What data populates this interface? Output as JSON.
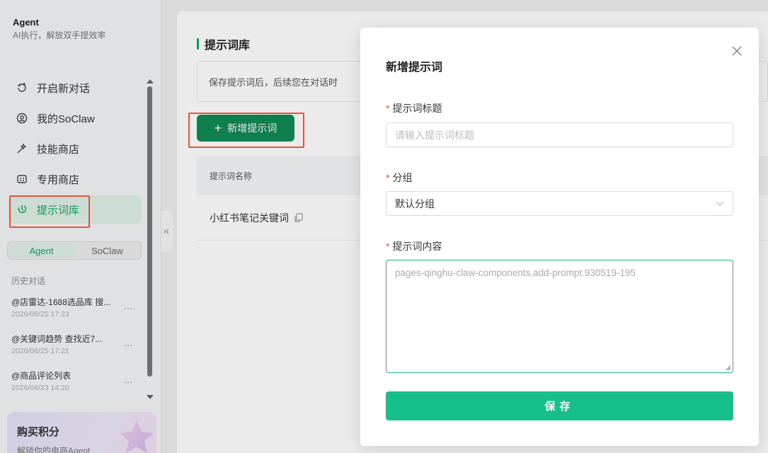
{
  "brand": {
    "title": "Agent",
    "subtitle": "AI执行，解放双手提效率"
  },
  "nav": [
    {
      "label": "开启新对话",
      "icon": "new-chat-icon"
    },
    {
      "label": "我的SoClaw",
      "icon": "user-icon"
    },
    {
      "label": "技能商店",
      "icon": "skill-icon"
    },
    {
      "label": "专用商店",
      "icon": "store-icon"
    },
    {
      "label": "提示词库",
      "icon": "prompt-icon",
      "active": true
    }
  ],
  "segment": {
    "left": "Agent",
    "right": "SoClaw",
    "selected": "Agent"
  },
  "history": {
    "label": "历史对话",
    "items": [
      {
        "title": "@店雷达-1688选品库 搜...",
        "time": "2026/06/25 17:23"
      },
      {
        "title": "@关键词趋势 查找近7...",
        "time": "2026/06/25 17:21"
      },
      {
        "title": "@商品评论列表",
        "time": "2026/06/23 14:20"
      }
    ],
    "more": "..."
  },
  "promo": {
    "title": "购买积分",
    "subtitle": "解锁你的电商Agent"
  },
  "main": {
    "title": "提示词库",
    "info": "保存提示词后，后续您在对话时",
    "add_button": "新增提示词",
    "add_plus": "+",
    "table_header": "提示词名称",
    "rows": [
      {
        "name": "小红书笔记关键词"
      }
    ]
  },
  "modal": {
    "title": "新增提示词",
    "fields": {
      "title_label": "提示词标题",
      "title_placeholder": "请输入提示词标题",
      "group_label": "分组",
      "group_value": "默认分组",
      "content_label": "提示词内容",
      "content_placeholder": "pages-qinghu-claw-components.add-prompt.930519-195"
    },
    "required_mark": "*",
    "save": "保存"
  },
  "colors": {
    "accent": "#1aa26a",
    "button": "#17c08a",
    "highlight": "#e9533a"
  }
}
